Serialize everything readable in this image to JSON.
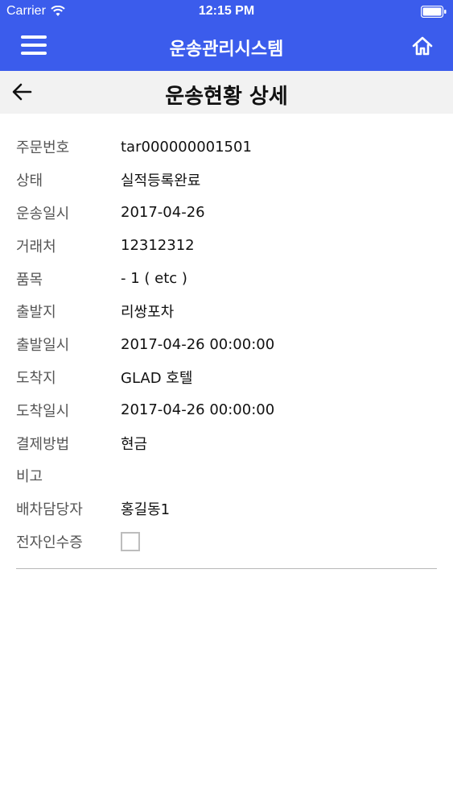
{
  "status_bar": {
    "carrier": "Carrier",
    "time": "12:15 PM"
  },
  "app_bar": {
    "title": "운송관리시스템",
    "menu_icon": "hamburger-menu-icon",
    "home_icon": "home-icon",
    "color": "#3b5cec"
  },
  "sub_header": {
    "title": "운송현황 상세",
    "back_icon": "arrow-left-icon"
  },
  "details": [
    {
      "label": "주문번호",
      "value": "tar000000001501"
    },
    {
      "label": "상태",
      "value": "실적등록완료"
    },
    {
      "label": "운송일시",
      "value": "2017-04-26"
    },
    {
      "label": "거래처",
      "value": "12312312"
    },
    {
      "label": "품목",
      "value": "- 1 ( etc )"
    },
    {
      "label": "출발지",
      "value": "리쌍포차"
    },
    {
      "label": "출발일시",
      "value": "2017-04-26 00:00:00"
    },
    {
      "label": "도착지",
      "value": "GLAD 호텔"
    },
    {
      "label": "도착일시",
      "value": "2017-04-26 00:00:00"
    },
    {
      "label": "결제방법",
      "value": "현금"
    },
    {
      "label": "비고",
      "value": ""
    },
    {
      "label": "배차담당자",
      "value": "홍길동1"
    },
    {
      "label": "전자인수증",
      "checked": false
    }
  ]
}
